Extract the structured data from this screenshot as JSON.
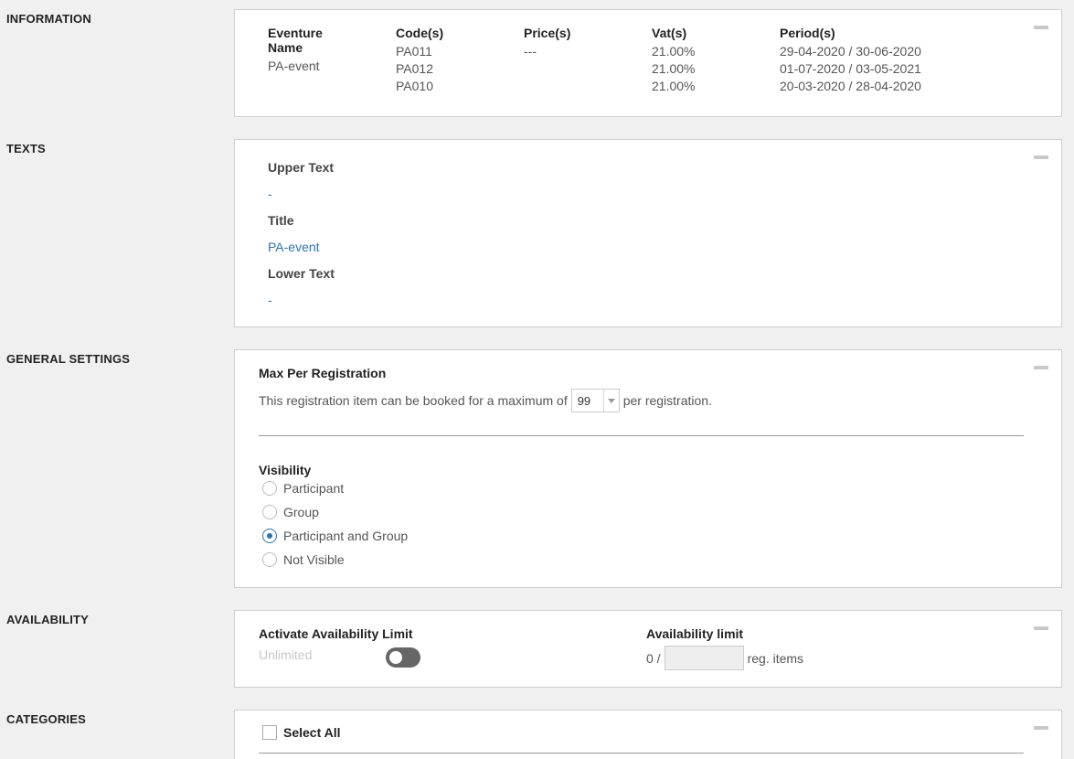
{
  "sections": {
    "information": "INFORMATION",
    "texts": "TEXTS",
    "general_settings": "GENERAL SETTINGS",
    "availability": "AVAILABILITY",
    "categories": "CATEGORIES"
  },
  "information": {
    "headers": [
      "Eventure Name",
      "Code(s)",
      "Price(s)",
      "Vat(s)",
      "Period(s)"
    ],
    "name": "PA-event",
    "codes": [
      "PA011",
      "PA012",
      "PA010"
    ],
    "price": "---",
    "vats": [
      "21.00%",
      "21.00%",
      "21.00%"
    ],
    "periods": [
      "29-04-2020 / 30-06-2020",
      "01-07-2020 / 03-05-2021",
      "20-03-2020 / 28-04-2020"
    ]
  },
  "texts": {
    "upper_label": "Upper Text",
    "upper_value": "-",
    "title_label": "Title",
    "title_value": "PA-event",
    "lower_label": "Lower Text",
    "lower_value": "-"
  },
  "general": {
    "max_title": "Max Per Registration",
    "max_desc_before": "This registration item can be booked for a maximum of",
    "max_value": "99",
    "max_desc_after": "per registration.",
    "visibility_title": "Visibility",
    "visibility_options": [
      "Participant",
      "Group",
      "Participant and Group",
      "Not Visible"
    ],
    "visibility_selected": "Participant and Group"
  },
  "availability": {
    "activate_label": "Activate Availability Limit",
    "unlimited": "Unlimited",
    "limit_label": "Availability limit",
    "current": "0 /",
    "unit": "reg. items"
  },
  "categories": {
    "select_all": "Select All"
  },
  "colors": {
    "accent": "#2a73b8",
    "background": "#f0f0f0"
  }
}
